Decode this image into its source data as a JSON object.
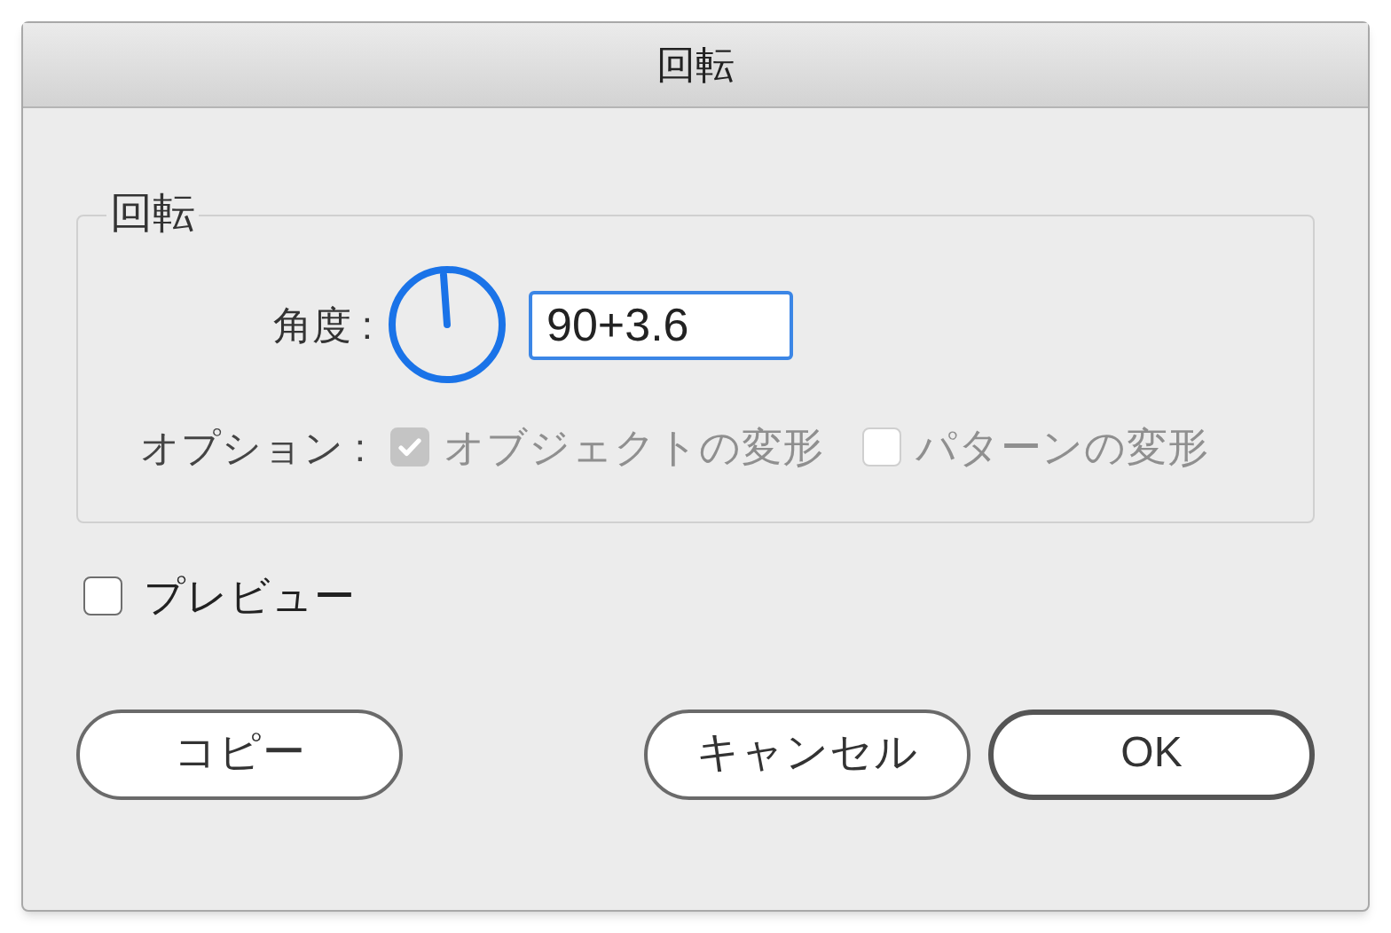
{
  "window": {
    "title": "回転"
  },
  "group": {
    "legend": "回転",
    "angle": {
      "label": "角度 :",
      "value": "90+3.6"
    },
    "options": {
      "label": "オプション :",
      "disabled": true,
      "items": [
        {
          "label": "オブジェクトの変形",
          "checked": true
        },
        {
          "label": "パターンの変形",
          "checked": false
        }
      ]
    }
  },
  "preview": {
    "label": "プレビュー",
    "checked": false
  },
  "buttons": [
    {
      "label": "コピー",
      "default": false
    },
    {
      "label": "キャンセル",
      "default": false
    },
    {
      "label": "OK",
      "default": true
    }
  ]
}
